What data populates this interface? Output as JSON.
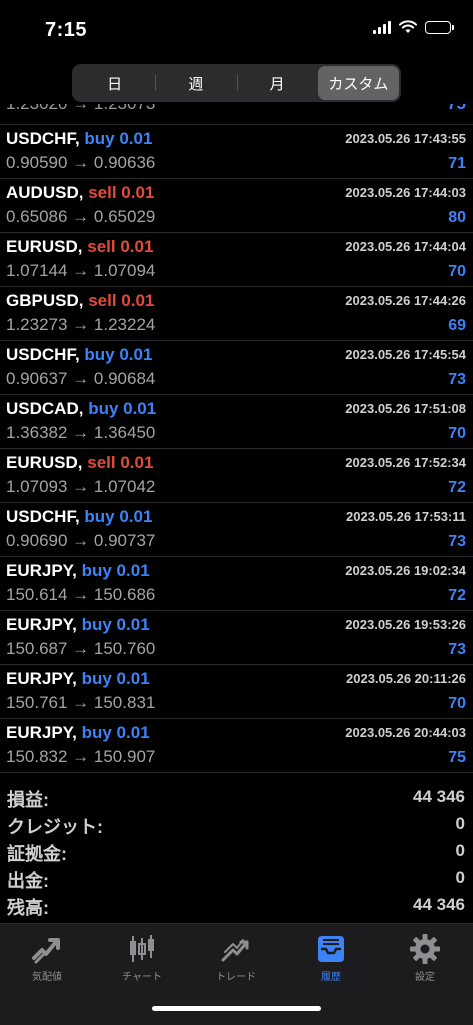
{
  "status": {
    "time": "7:15"
  },
  "segments": [
    {
      "label": "日",
      "active": false
    },
    {
      "label": "週",
      "active": false
    },
    {
      "label": "月",
      "active": false
    },
    {
      "label": "カスタム",
      "active": true
    }
  ],
  "partial_row": {
    "prices": "1.23020 → 1.23073",
    "profit": "75"
  },
  "trades": [
    {
      "symbol": "USDCHF,",
      "side": "buy 0.01",
      "time": "2023.05.26 17:43:55",
      "prices": "0.90590 → 0.90636",
      "profit": "71"
    },
    {
      "symbol": "AUDUSD,",
      "side": "sell 0.01",
      "time": "2023.05.26 17:44:03",
      "prices": "0.65086 → 0.65029",
      "profit": "80"
    },
    {
      "symbol": "EURUSD,",
      "side": "sell 0.01",
      "time": "2023.05.26 17:44:04",
      "prices": "1.07144 → 1.07094",
      "profit": "70"
    },
    {
      "symbol": "GBPUSD,",
      "side": "sell 0.01",
      "time": "2023.05.26 17:44:26",
      "prices": "1.23273 → 1.23224",
      "profit": "69"
    },
    {
      "symbol": "USDCHF,",
      "side": "buy 0.01",
      "time": "2023.05.26 17:45:54",
      "prices": "0.90637 → 0.90684",
      "profit": "73"
    },
    {
      "symbol": "USDCAD,",
      "side": "buy 0.01",
      "time": "2023.05.26 17:51:08",
      "prices": "1.36382 → 1.36450",
      "profit": "70"
    },
    {
      "symbol": "EURUSD,",
      "side": "sell 0.01",
      "time": "2023.05.26 17:52:34",
      "prices": "1.07093 → 1.07042",
      "profit": "72"
    },
    {
      "symbol": "USDCHF,",
      "side": "buy 0.01",
      "time": "2023.05.26 17:53:11",
      "prices": "0.90690 → 0.90737",
      "profit": "73"
    },
    {
      "symbol": "EURJPY,",
      "side": "buy 0.01",
      "time": "2023.05.26 19:02:34",
      "prices": "150.614 → 150.686",
      "profit": "72"
    },
    {
      "symbol": "EURJPY,",
      "side": "buy 0.01",
      "time": "2023.05.26 19:53:26",
      "prices": "150.687 → 150.760",
      "profit": "73"
    },
    {
      "symbol": "EURJPY,",
      "side": "buy 0.01",
      "time": "2023.05.26 20:11:26",
      "prices": "150.761 → 150.831",
      "profit": "70"
    },
    {
      "symbol": "EURJPY,",
      "side": "buy 0.01",
      "time": "2023.05.26 20:44:03",
      "prices": "150.832 → 150.907",
      "profit": "75"
    }
  ],
  "summary": [
    {
      "label": "損益:",
      "value": "44 346"
    },
    {
      "label": "クレジット:",
      "value": "0"
    },
    {
      "label": "証拠金:",
      "value": "0"
    },
    {
      "label": "出金:",
      "value": "0"
    },
    {
      "label": "残高:",
      "value": "44 346"
    }
  ],
  "tabs": [
    {
      "label": "気配値",
      "icon": "quotes-icon",
      "active": false
    },
    {
      "label": "チャート",
      "icon": "candlestick-chart-icon",
      "active": false
    },
    {
      "label": "トレード",
      "icon": "trade-icon",
      "active": false
    },
    {
      "label": "履歴",
      "icon": "history-inbox-icon",
      "active": true
    },
    {
      "label": "設定",
      "icon": "settings-gear-icon",
      "active": false
    }
  ],
  "colors": {
    "buy": "#3d82f6",
    "sell": "#e24a3b",
    "active_tab": "#3d82f6",
    "inactive_tab": "#8e8e93"
  }
}
